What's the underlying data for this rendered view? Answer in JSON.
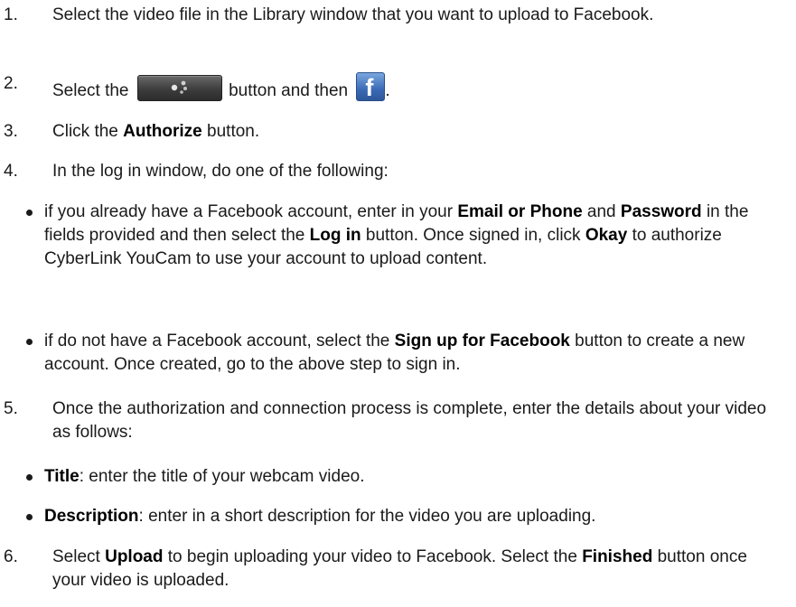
{
  "steps": [
    {
      "number": "1.",
      "text": "Select the video file in the Library window that you want to upload to Facebook."
    },
    {
      "number": "2.",
      "text_before": "Select the",
      "text_middle": "button and then",
      "text_after": "."
    },
    {
      "number": "3.",
      "p1": "Click the ",
      "b1": "Authorize",
      "p2": " button."
    },
    {
      "number": "4.",
      "text": "In the log in window, do one of the following:",
      "bullets": [
        {
          "p1": "if you already have a Facebook account, enter in your ",
          "b1": "Email or Phone",
          "p2": " and ",
          "b2": "Password",
          "p3": " in the fields provided and then select the ",
          "b3": "Log in",
          "p4": " button. Once signed in, click ",
          "b4": "Okay",
          "p5": " to authorize CyberLink YouCam to use your account to upload content."
        },
        {
          "p1": "if do not have a Facebook account, select the ",
          "b1": "Sign up for Facebook",
          "p2": " button to create a new account. Once created, go to the above step to sign in."
        }
      ]
    },
    {
      "number": "5.",
      "text": "Once the authorization and connection process is complete, enter the details about your video as follows:",
      "bullets": [
        {
          "b1": "Title",
          "p1": ": enter the title of your webcam video."
        },
        {
          "b1": "Description",
          "p1": ": enter in a short description for the video you are uploading."
        }
      ]
    },
    {
      "number": "6.",
      "p1": "Select ",
      "b1": "Upload",
      "p2": " to begin uploading your video to Facebook. Select the ",
      "b2": "Finished",
      "p3": " button once your video is uploaded."
    }
  ],
  "icons": {
    "share_button": "share-icon",
    "facebook_button": "facebook-icon",
    "facebook_letter": "f"
  },
  "colors": {
    "text": "#1a1a1a",
    "facebook_blue": "#3b6bb5",
    "share_button_dark": "#3d3d3d"
  }
}
